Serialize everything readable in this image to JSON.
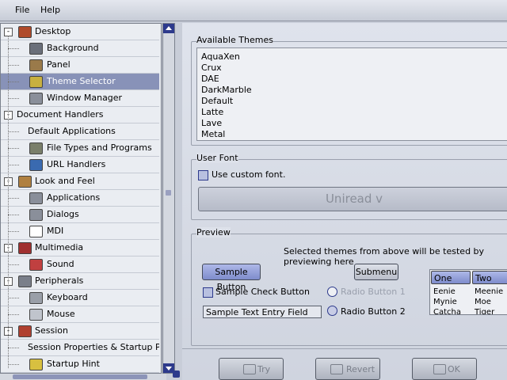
{
  "menu": {
    "file": "File",
    "help": "Help"
  },
  "tree": [
    {
      "label": "Desktop",
      "level": 0,
      "expander": "-",
      "icon": "desktop-icon",
      "color": "#b04a2a"
    },
    {
      "label": "Background",
      "level": 1,
      "icon": "monitor-icon",
      "color": "#6a6f7a"
    },
    {
      "label": "Panel",
      "level": 1,
      "icon": "panel-icon",
      "color": "#9a7a4a"
    },
    {
      "label": "Theme Selector",
      "level": 1,
      "icon": "paint-icon",
      "color": "#c8b040",
      "selected": true
    },
    {
      "label": "Window Manager",
      "level": 1,
      "icon": "window-icon",
      "color": "#8a8f9a"
    },
    {
      "label": "Document Handlers",
      "level": 0,
      "expander": "-"
    },
    {
      "label": "Default Applications",
      "level": 1
    },
    {
      "label": "File Types and Programs",
      "level": 1,
      "icon": "filetypes-icon",
      "color": "#7a7f6a"
    },
    {
      "label": "URL Handlers",
      "level": 1,
      "icon": "globe-icon",
      "color": "#3a6ab0"
    },
    {
      "label": "Look and Feel",
      "level": 0,
      "expander": "-",
      "icon": "palette-icon",
      "color": "#b08040"
    },
    {
      "label": "Applications",
      "level": 1,
      "icon": "app-icon",
      "color": "#8a8f9a"
    },
    {
      "label": "Dialogs",
      "level": 1,
      "icon": "dialog-icon",
      "color": "#8a8f9a"
    },
    {
      "label": "MDI",
      "level": 1,
      "icon": "mdi-icon",
      "color": "#ffffff"
    },
    {
      "label": "Multimedia",
      "level": 0,
      "expander": "-",
      "icon": "multimedia-icon",
      "color": "#a03030"
    },
    {
      "label": "Sound",
      "level": 1,
      "icon": "sound-icon",
      "color": "#c04040"
    },
    {
      "label": "Peripherals",
      "level": 0,
      "expander": "-",
      "icon": "peripherals-icon",
      "color": "#7a7f8a"
    },
    {
      "label": "Keyboard",
      "level": 1,
      "icon": "keyboard-icon",
      "color": "#9a9fa8"
    },
    {
      "label": "Mouse",
      "level": 1,
      "icon": "mouse-icon",
      "color": "#c0c4cc"
    },
    {
      "label": "Session",
      "level": 0,
      "expander": "-",
      "icon": "session-icon",
      "color": "#b04030"
    },
    {
      "label": "Session Properties & Startup Progr",
      "level": 1
    },
    {
      "label": "Startup Hint",
      "level": 1,
      "icon": "lightbulb-icon",
      "color": "#d8c040"
    }
  ],
  "themes": {
    "title": "Available Themes",
    "items": [
      "AquaXen",
      "Crux",
      "DAE",
      "DarkMarble",
      "Default",
      "Latte",
      "Lave",
      "Metal"
    ]
  },
  "userfont": {
    "title": "User Font",
    "check_label": "Use custom font.",
    "font_button": "Uniread v"
  },
  "preview": {
    "title": "Preview",
    "note": "Selected themes from above will be tested by previewing here",
    "sample_button": "Sample Button",
    "submenu": "Submenu",
    "check_label": "Sample Check Button",
    "entry_value": "Sample Text Entry Field",
    "radio1": "Radio Button 1",
    "radio2": "Radio Button 2",
    "clist_headers": [
      "One",
      "Two"
    ],
    "clist_rows": [
      [
        "Eenie",
        "Meenie"
      ],
      [
        "Mynie",
        "Moe"
      ],
      [
        "Catcha",
        "Tiger"
      ]
    ]
  },
  "actions": {
    "try": "Try",
    "revert": "Revert",
    "ok": "OK"
  }
}
